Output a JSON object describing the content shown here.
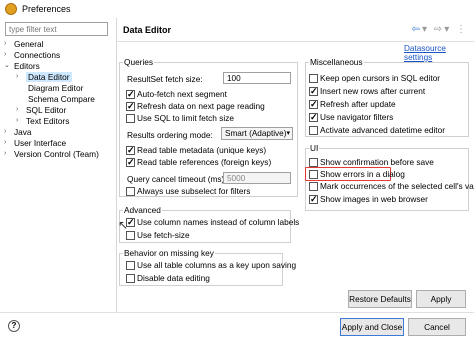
{
  "window": {
    "title": "Preferences"
  },
  "filter": {
    "placeholder": "type filter text"
  },
  "tree": [
    {
      "label": "General",
      "expand": "›"
    },
    {
      "label": "Connections",
      "expand": "›"
    },
    {
      "label": "Editors",
      "expand": "⌄"
    },
    {
      "label": "Data Editor",
      "expand": "›"
    },
    {
      "label": "Diagram Editor",
      "expand": ""
    },
    {
      "label": "Schema Compare",
      "expand": ""
    },
    {
      "label": "SQL Editor",
      "expand": "›"
    },
    {
      "label": "Text Editors",
      "expand": "›"
    },
    {
      "label": "Java",
      "expand": "›"
    },
    {
      "label": "User Interface",
      "expand": "›"
    },
    {
      "label": "Version Control (Team)",
      "expand": "›"
    }
  ],
  "page": {
    "title": "Data Editor",
    "datasource_link": "Datasource settings"
  },
  "queries": {
    "legend": "Queries",
    "fetch_size_label": "ResultSet fetch size:",
    "fetch_size_value": "100",
    "auto_fetch": "Auto-fetch next segment",
    "refresh_next": "Refresh data on next page reading",
    "use_sql_limit": "Use SQL to limit fetch size",
    "ordering_label": "Results ordering mode:",
    "ordering_value": "Smart (Adaptive)",
    "read_meta": "Read table metadata (unique keys)",
    "read_refs": "Read table references (foreign keys)",
    "timeout_label": "Query cancel timeout (ms):",
    "timeout_value": "5000",
    "always_subselect": "Always use subselect for filters"
  },
  "misc": {
    "legend": "Miscellaneous",
    "keep_cursors": "Keep open cursors in SQL editor",
    "insert_rows": "Insert new rows after current",
    "refresh_after": "Refresh after update",
    "use_nav": "Use navigator filters",
    "activate_dt": "Activate advanced datetime editor"
  },
  "ui": {
    "legend": "UI",
    "show_confirm": "Show confirmation before save",
    "show_errors": "Show errors in a dialog",
    "mark_occ": "Mark occurrences of the selected cell's value",
    "show_images": "Show images in web browser"
  },
  "advanced": {
    "legend": "Advanced",
    "use_col_names": "Use column names instead of column labels",
    "use_fetch_size": "Use fetch-size"
  },
  "missing_key": {
    "legend": "Behavior on missing key",
    "use_all_cols": "Use all table columns as a key upon saving",
    "disable_edit": "Disable data editing"
  },
  "buttons": {
    "restore": "Restore Defaults",
    "apply": "Apply",
    "apply_close": "Apply and Close",
    "cancel": "Cancel"
  },
  "icons": {
    "help": "?"
  }
}
